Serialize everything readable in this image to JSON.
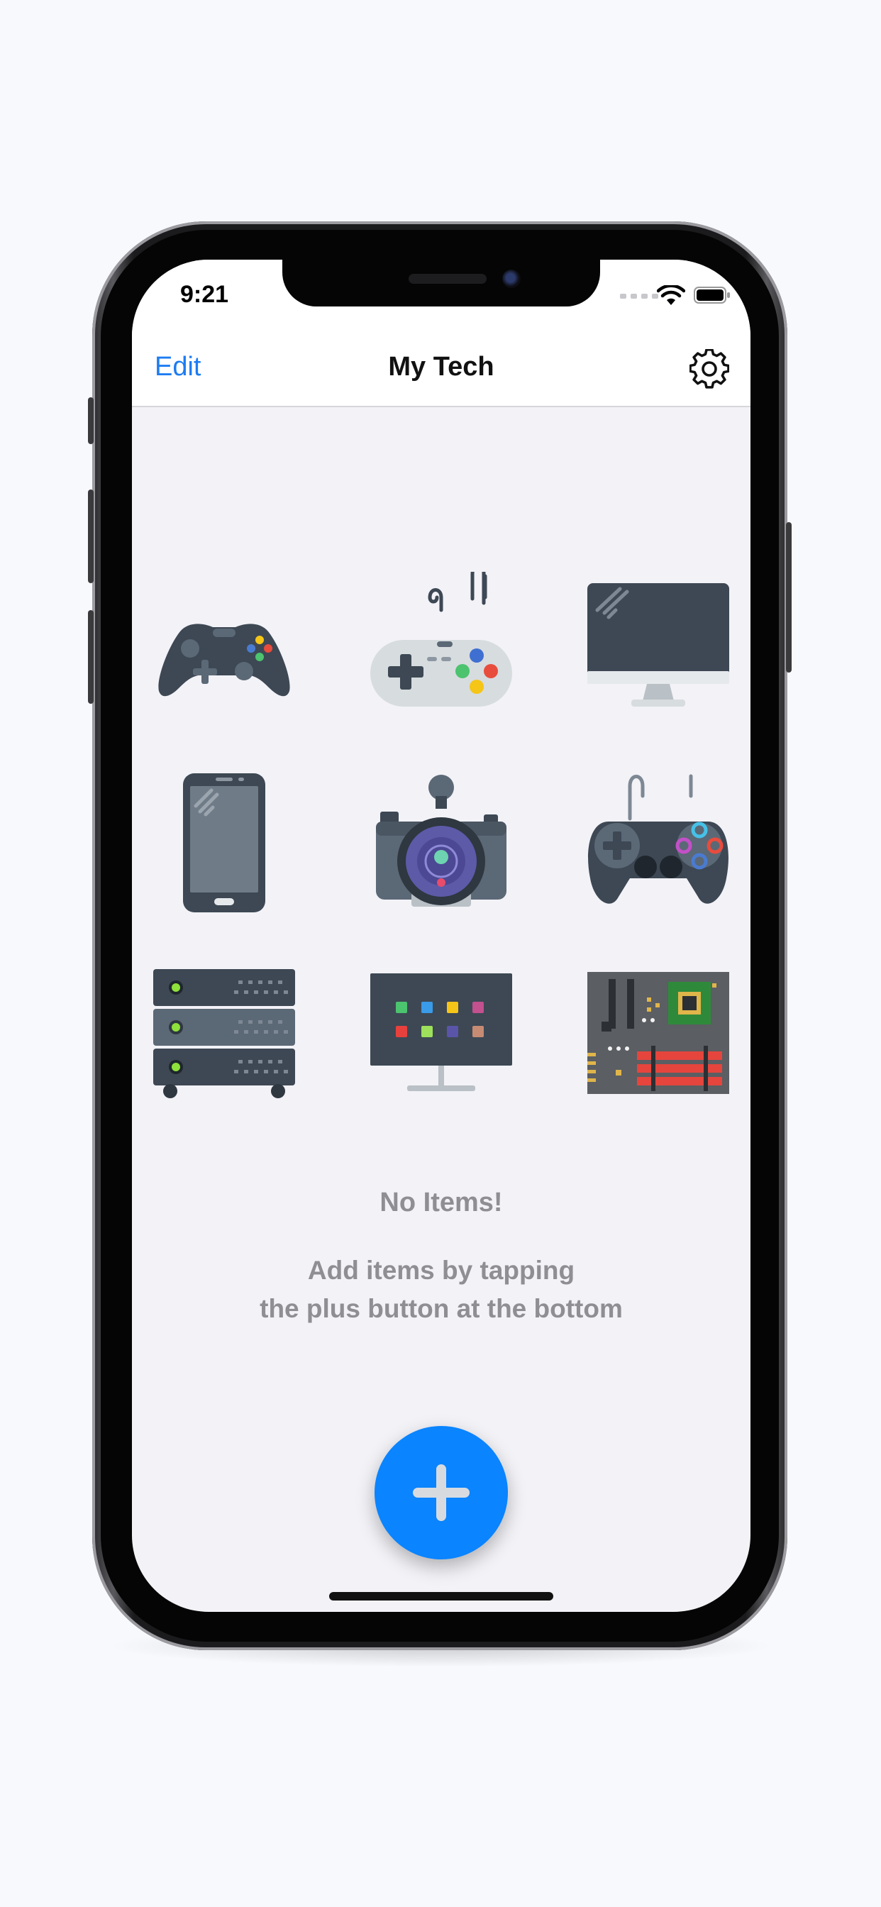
{
  "status_bar": {
    "time": "9:21"
  },
  "nav": {
    "edit_label": "Edit",
    "title": "My Tech",
    "settings_icon": "gear-icon"
  },
  "grid": {
    "icons": [
      "xbox-controller-icon",
      "snes-controller-icon",
      "desktop-monitor-icon",
      "smartphone-icon",
      "camera-icon",
      "ps-controller-icon",
      "server-rack-icon",
      "smart-tv-icon",
      "motherboard-icon"
    ]
  },
  "empty_state": {
    "title": "No Items!",
    "line1": "Add items by tapping",
    "line2": "the plus button at the bottom"
  },
  "fab": {
    "icon": "plus-icon"
  },
  "colors": {
    "accent": "#0a84ff",
    "link": "#1d7cf2",
    "background": "#f2f2f7",
    "muted_text": "#8e8e93"
  }
}
